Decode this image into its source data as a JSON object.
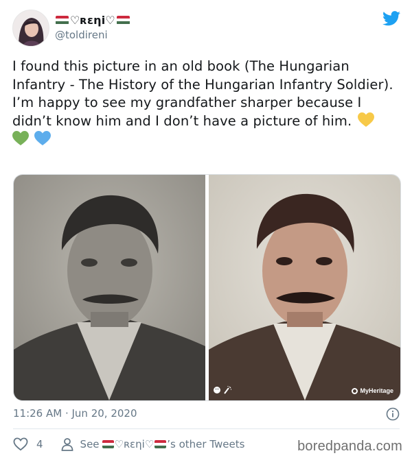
{
  "tweet": {
    "display_name": "♡ʀεηi♡",
    "handle": "@toldireni",
    "body_lines": [
      "I found this picture in an old book (The Hungarian Infantry - The History of the Hungarian Infantry Soldier).",
      "I’m happy to see my grandfather sharper because I didn’t know him and I don’t have a picture of him."
    ],
    "emoji": [
      "yellow-heart",
      "green-heart",
      "blue-heart"
    ],
    "media_watermark": "MyHeritage",
    "timestamp": "11:26 AM · Jun 20, 2020",
    "likes": "4",
    "see_prefix": "See",
    "see_suffix": "’s other Tweets"
  },
  "brand": {
    "twitter_blue": "#1da1f2",
    "flag_red": "#cd2a3e",
    "flag_green": "#436f4d",
    "heart_yellow": "#f7c948",
    "heart_green": "#78b159",
    "heart_blue": "#5dadec"
  },
  "site_watermark": "boredpanda.com",
  "icons": [
    "twitter-bird-icon",
    "info-icon",
    "heart-outline-icon",
    "person-icon",
    "edit-tools-icon"
  ]
}
